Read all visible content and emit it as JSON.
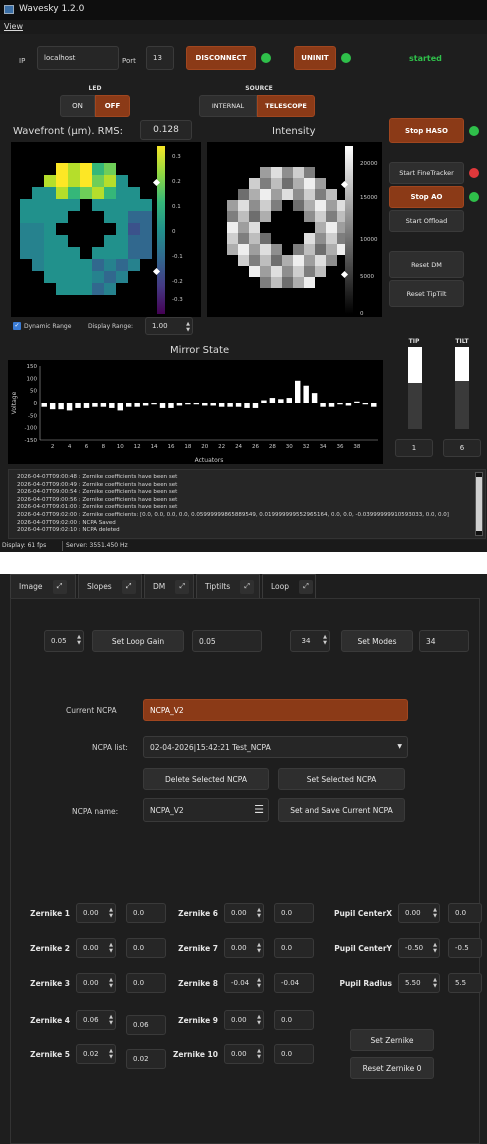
{
  "window": {
    "title": "Wavesky 1.2.0",
    "menu": "View"
  },
  "connection": {
    "ip_label": "IP",
    "ip_value": "localhost",
    "port_label": "Port",
    "port_value": "13",
    "disconnect_label": "DISCONNECT",
    "uninit_label": "UNINIT",
    "status_text": "started"
  },
  "led": {
    "header": "LED",
    "on_label": "ON",
    "off_label": "OFF"
  },
  "source": {
    "header": "SOURCE",
    "internal_label": "INTERNAL",
    "telescope_label": "TELESCOPE"
  },
  "wavefront": {
    "title": "Wavefront (µm). RMS:",
    "rms_value": "0.128",
    "ticks": [
      "0.3",
      "0.2",
      "0.1",
      "0",
      "-0.1",
      "-0.2",
      "-0.3"
    ]
  },
  "intensity": {
    "title": "Intensity",
    "ticks": [
      "20000",
      "15000",
      "10000",
      "5000",
      "0"
    ]
  },
  "controls": {
    "stop_haso": "Stop HASO",
    "start_finetracker": "Start FineTracker",
    "stop_ao": "Stop AO",
    "start_offload": "Start Offload",
    "reset_dm": "Reset DM",
    "reset_tiptilt": "Reset TipTilt"
  },
  "display": {
    "dynamic_range_label": "Dynamic Range",
    "display_range_label": "Display Range:",
    "display_range_value": "1.00"
  },
  "mirror": {
    "title": "Mirror State",
    "ylabel": "Voltage",
    "xlabel": "Actuators",
    "yticks": [
      "150",
      "100",
      "50",
      "0",
      "-50",
      "-100",
      "-150"
    ],
    "xticks": [
      "2",
      "4",
      "6",
      "8",
      "10",
      "12",
      "14",
      "16",
      "18",
      "20",
      "22",
      "24",
      "26",
      "28",
      "30",
      "32",
      "34",
      "36",
      "38"
    ]
  },
  "tiptilt": {
    "tip_label": "TIP",
    "tilt_label": "TILT",
    "tip_value": "1",
    "tilt_value": "6",
    "tip_level": 0.36,
    "tilt_level": 0.16
  },
  "log": {
    "lines": [
      "2026-04-07T09:00:48 : Zernike coefficients have been set",
      "2026-04-07T09:00:49 : Zernike coefficients have been set",
      "2026-04-07T09:00:54 : Zernike coefficients have been set",
      "2026-04-07T09:00:56 : Zernike coefficients have been set",
      "2026-04-07T09:01:00 : Zernike coefficients have been set",
      "2026-04-07T09:02:00 : Zernike coefficients: [0.0, 0.0, 0.0, 0.0, 0.05999999865889549, 0.019999999552965164, 0.0, 0.0, -0.03999999910593033, 0.0, 0.0]",
      "2026-04-07T09:02:00 : NCPA Saved",
      "2026-04-07T09:02:10 : NCPA deleted"
    ]
  },
  "statusbar": {
    "fps": "Display: 61 fps",
    "server": "Server: 3551.450 Hz"
  },
  "tabs": [
    {
      "label": "Image"
    },
    {
      "label": "Slopes"
    },
    {
      "label": "DM"
    },
    {
      "label": "Tiptilts"
    },
    {
      "label": "Loop"
    }
  ],
  "loop": {
    "gain_spin": "0.05",
    "set_loop_gain": "Set Loop Gain",
    "gain_value": "0.05",
    "modes_spin": "34",
    "set_modes": "Set Modes",
    "modes_value": "34"
  },
  "ncpa": {
    "current_label": "Current NCPA",
    "current_value": "NCPA_V2",
    "list_label": "NCPA list:",
    "list_value": "02-04-2026|15:42:21 Test_NCPA",
    "delete_label": "Delete Selected NCPA",
    "set_selected_label": "Set Selected NCPA",
    "name_label": "NCPA name:",
    "name_value": "NCPA_V2",
    "set_save_label": "Set and Save Current NCPA"
  },
  "zernike": [
    {
      "label": "Zernike 1",
      "spin": "0.00",
      "value": "0.0"
    },
    {
      "label": "Zernike 2",
      "spin": "0.00",
      "value": "0.0"
    },
    {
      "label": "Zernike 3",
      "spin": "0.00",
      "value": "0.0"
    },
    {
      "label": "Zernike 4",
      "spin": "0.06",
      "value": "0.06"
    },
    {
      "label": "Zernike 5",
      "spin": "0.02",
      "value": "0.02"
    },
    {
      "label": "Zernike 6",
      "spin": "0.00",
      "value": "0.0"
    },
    {
      "label": "Zernike 7",
      "spin": "0.00",
      "value": "0.0"
    },
    {
      "label": "Zernike 8",
      "spin": "-0.04",
      "value": "-0.04"
    },
    {
      "label": "Zernike 9",
      "spin": "0.00",
      "value": "0.0"
    },
    {
      "label": "Zernike 10",
      "spin": "0.00",
      "value": "0.0"
    }
  ],
  "pupil": [
    {
      "label": "Pupil CenterX",
      "spin": "0.00",
      "value": "0.0"
    },
    {
      "label": "Pupil CenterY",
      "spin": "-0.50",
      "value": "-0.5"
    },
    {
      "label": "Pupil Radius",
      "spin": "5.50",
      "value": "5.5"
    }
  ],
  "zernike_buttons": {
    "set": "Set Zernike",
    "reset": "Reset Zernike 0"
  },
  "chart_data": {
    "type": "bar",
    "title": "Mirror State",
    "xlabel": "Actuators",
    "ylabel": "Voltage",
    "ylim": [
      -150,
      150
    ],
    "categories": [
      1,
      2,
      3,
      4,
      5,
      6,
      7,
      8,
      9,
      10,
      11,
      12,
      13,
      14,
      15,
      16,
      17,
      18,
      19,
      20,
      21,
      22,
      23,
      24,
      25,
      26,
      27,
      28,
      29,
      30,
      31,
      32,
      33,
      34,
      35,
      36,
      37,
      38,
      39,
      40
    ],
    "values": [
      -15,
      -25,
      -25,
      -30,
      -20,
      -20,
      -15,
      -15,
      -20,
      -30,
      -15,
      -15,
      -10,
      -5,
      -20,
      -20,
      -10,
      -5,
      -5,
      -10,
      -10,
      -15,
      -15,
      -15,
      -20,
      -20,
      10,
      20,
      15,
      20,
      90,
      70,
      40,
      -15,
      -15,
      -5,
      -10,
      5,
      -5,
      -15
    ]
  }
}
